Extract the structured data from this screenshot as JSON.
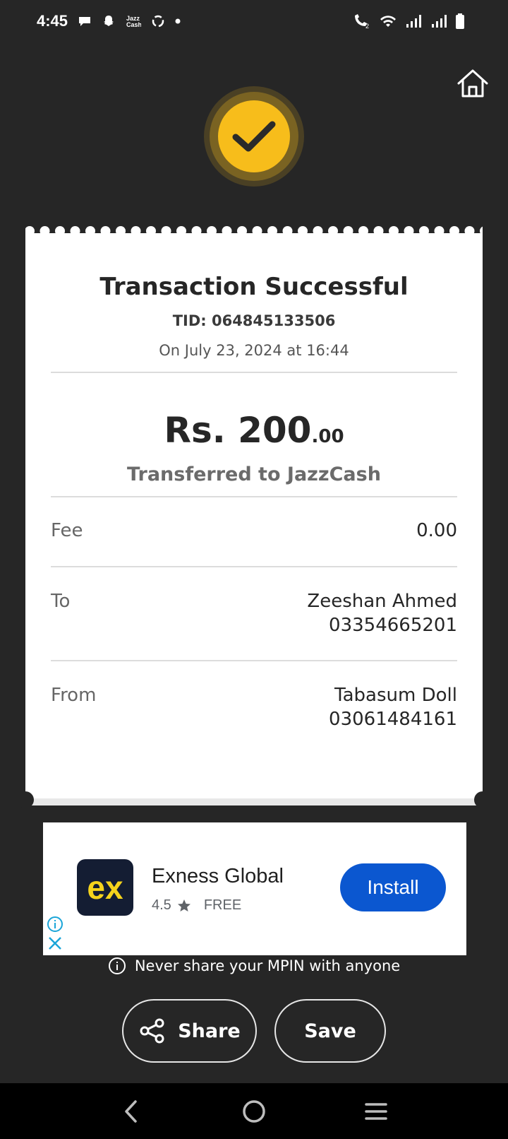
{
  "status_bar": {
    "time": "4:45",
    "left_icons": [
      "chat-icon",
      "snapchat-icon",
      "jazzcash-icon",
      "recycle-icon",
      "dot-icon"
    ],
    "right_icons": [
      "wifi-calling-icon",
      "wifi-icon",
      "signal-icon",
      "signal-icon",
      "battery-icon"
    ]
  },
  "header": {
    "home_icon": "home-icon",
    "success_icon": "checkmark-icon",
    "accent_color": "#f7bd1b"
  },
  "receipt": {
    "title": "Transaction Successful",
    "tid": "TID: 064845133506",
    "date": "On July 23, 2024 at 16:44",
    "amount_main": "Rs. 200",
    "amount_decimal": ".00",
    "transferred_to": "Transferred to JazzCash",
    "fee": {
      "label": "Fee",
      "value": "0.00"
    },
    "to": {
      "label": "To",
      "name": "Zeeshan Ahmed",
      "number": "03354665201"
    },
    "from": {
      "label": "From",
      "name": "Tabasum Doll",
      "number": "03061484161"
    }
  },
  "ad": {
    "logo_text": "ex",
    "app_name": "Exness Global",
    "rating": "4.5",
    "price": "FREE",
    "install_label": "Install",
    "install_color": "#0b57d0"
  },
  "notice": {
    "text": "Never share your MPIN with anyone"
  },
  "actions": {
    "share_label": "Share",
    "save_label": "Save"
  },
  "nav": {
    "back_icon": "back-icon",
    "home_icon": "home-circle-icon",
    "menu_icon": "recents-icon"
  }
}
